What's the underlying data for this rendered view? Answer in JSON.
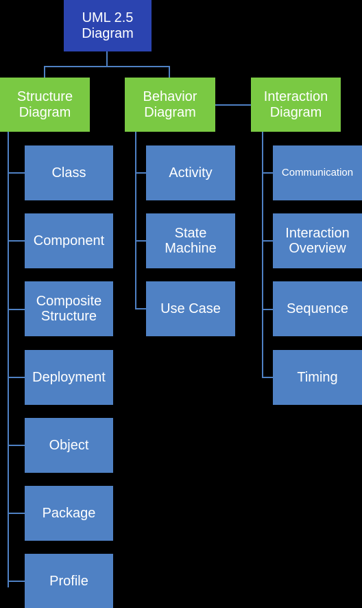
{
  "diagram": {
    "title": "UML 2.5 Diagram",
    "background_color": "#000000",
    "colors": {
      "root": "#2b44b0",
      "branch": "#7ac943",
      "leaf": "#4f81c4",
      "connector": "#4f81c4",
      "text": "#ffffff"
    },
    "root": {
      "label": "UML 2.5\nDiagram"
    },
    "branches": [
      {
        "label": "Structure\nDiagram"
      },
      {
        "label": "Behavior\nDiagram"
      },
      {
        "label": "Interaction\nDiagram"
      }
    ],
    "structure_children": [
      {
        "label": "Class"
      },
      {
        "label": "Component"
      },
      {
        "label": "Composite\nStructure"
      },
      {
        "label": "Deployment"
      },
      {
        "label": "Object"
      },
      {
        "label": "Package"
      },
      {
        "label": "Profile"
      }
    ],
    "behavior_children": [
      {
        "label": "Activity"
      },
      {
        "label": "State\nMachine"
      },
      {
        "label": "Use Case"
      }
    ],
    "interaction_children": [
      {
        "label": "Communication"
      },
      {
        "label": "Interaction\nOverview"
      },
      {
        "label": "Sequence"
      },
      {
        "label": "Timing"
      }
    ]
  }
}
